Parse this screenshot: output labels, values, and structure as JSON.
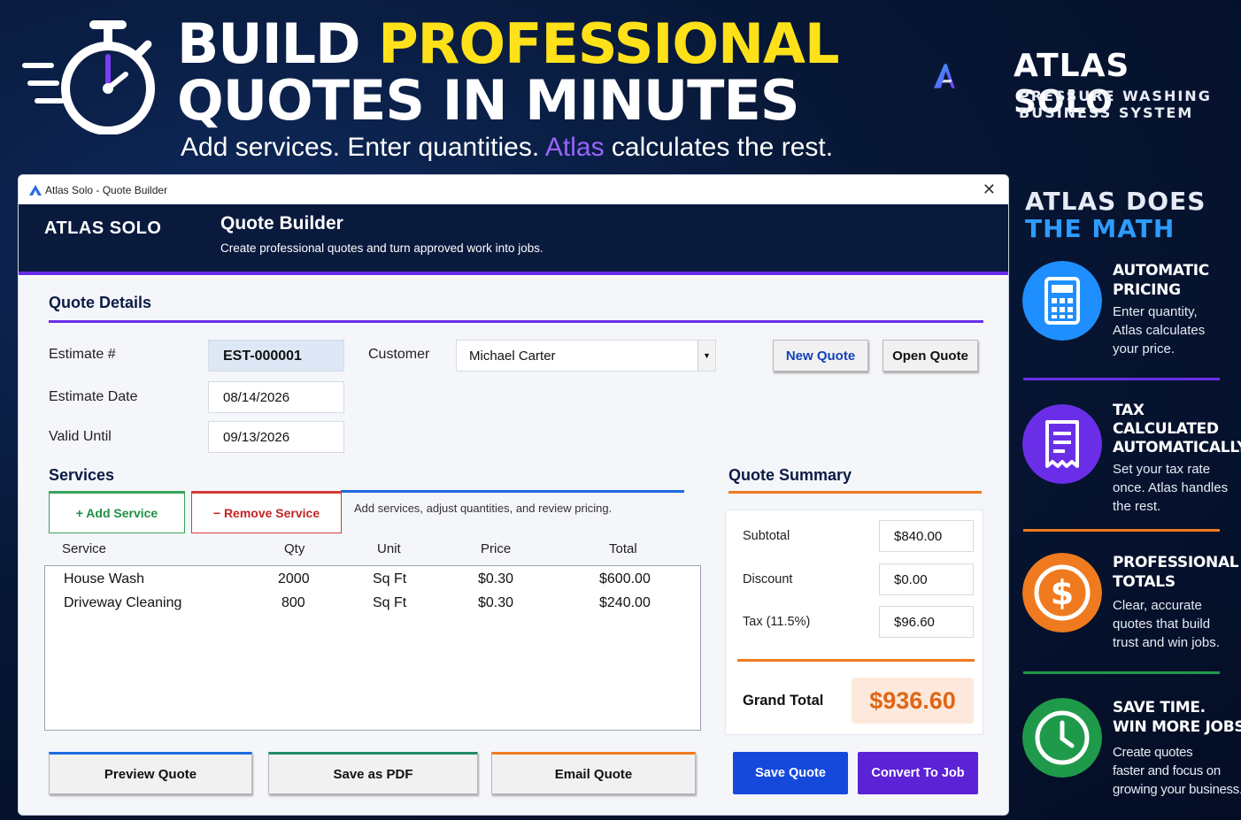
{
  "hero": {
    "title_line1_white": "BUILD ",
    "title_line1_yellow": "PROFESSIONAL",
    "title_line2": "QUOTES IN MINUTES",
    "subtitle_a": "Add services. Enter quantities. ",
    "subtitle_b": "Atlas",
    "subtitle_c": " calculates the rest.",
    "icon": "stopwatch-icon"
  },
  "brand": {
    "name": "ATLAS SOLO",
    "tagline1": "PRESSURE WASHING",
    "tagline2": "BUSINESS SYSTEM",
    "logo": "atlas-logo"
  },
  "window": {
    "title": "Atlas Solo - Quote Builder",
    "close": "✕",
    "app_name": "ATLAS SOLO",
    "page_title": "Quote Builder",
    "page_desc": "Create professional quotes and turn approved work into jobs."
  },
  "details": {
    "title": "Quote Details",
    "estimate_label": "Estimate #",
    "estimate_value": "EST-000001",
    "customer_label": "Customer",
    "customer_value": "Michael Carter",
    "date_label": "Estimate Date",
    "date_value": "08/14/2026",
    "valid_label": "Valid Until",
    "valid_value": "09/13/2026",
    "new_quote": "New Quote",
    "open_quote": "Open Quote"
  },
  "services": {
    "title": "Services",
    "add": "+ Add Service",
    "remove": "− Remove Service",
    "hint": "Add services, adjust quantities, and review pricing.",
    "columns": [
      "Service",
      "Qty",
      "Unit",
      "Price",
      "Total"
    ],
    "rows": [
      {
        "service": "House Wash",
        "qty": "2000",
        "unit": "Sq Ft",
        "price": "$0.30",
        "total": "$600.00"
      },
      {
        "service": "Driveway Cleaning",
        "qty": "800",
        "unit": "Sq Ft",
        "price": "$0.30",
        "total": "$240.00"
      }
    ]
  },
  "summary": {
    "title": "Quote Summary",
    "subtotal_label": "Subtotal",
    "subtotal": "$840.00",
    "discount_label": "Discount",
    "discount": "$0.00",
    "tax_label": "Tax (11.5%)",
    "tax": "$96.60",
    "grand_label": "Grand Total",
    "grand": "$936.60"
  },
  "actions": {
    "preview": "Preview Quote",
    "pdf": "Save as PDF",
    "email": "Email Quote",
    "save": "Save Quote",
    "convert": "Convert To Job"
  },
  "panel": {
    "head1": "ATLAS DOES",
    "head2": "THE MATH",
    "features": [
      {
        "title": "AUTOMATIC\nPRICING",
        "desc": "Enter quantity,\nAtlas calculates\nyour price.",
        "icon": "calculator-icon",
        "color": "#1f8fff"
      },
      {
        "title": "TAX\nCALCULATED\nAUTOMATICALLY",
        "desc": "Set your tax rate\nonce. Atlas handles\nthe rest.",
        "icon": "receipt-icon",
        "color": "#6a2ee8"
      },
      {
        "title": "PROFESSIONAL\nTOTALS",
        "desc": "Clear, accurate\nquotes that build\ntrust and win jobs.",
        "icon": "dollar-icon",
        "color": "#f07a1f"
      },
      {
        "title": "SAVE TIME.\nWIN MORE JOBS.",
        "desc": "Create quotes\nfaster and focus on\ngrowing your business.",
        "icon": "clock-icon",
        "color": "#1f9a4a"
      }
    ]
  },
  "colors": {
    "accent_purple": "#6a2ee8",
    "accent_blue": "#1f8fff",
    "accent_orange": "#f07a1f",
    "accent_green": "#1f9a4a",
    "highlight_yellow": "#ffe11a",
    "navy": "#0a1a3d"
  }
}
